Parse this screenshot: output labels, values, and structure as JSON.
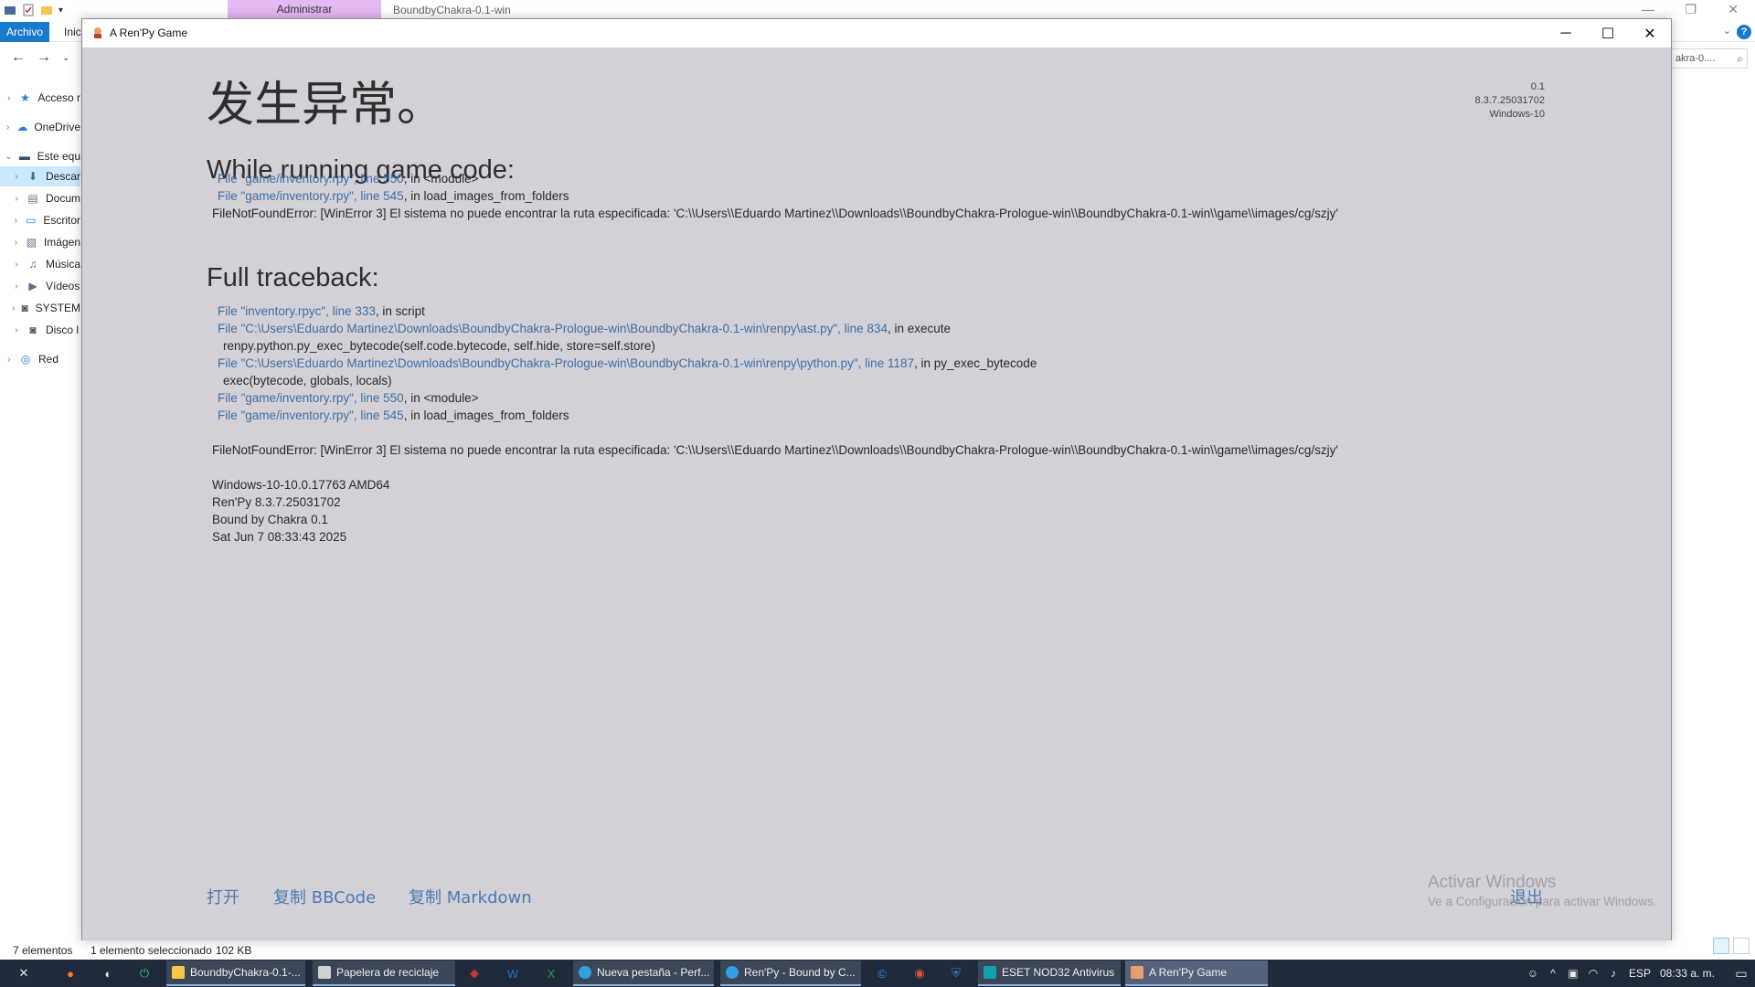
{
  "explorer": {
    "title": "BoundbyChakra-0.1-win",
    "manage_tab": "Administrar",
    "ribbon": {
      "file": "Archivo",
      "home": "Inic"
    },
    "search_text": "akra-0....",
    "sidebar": [
      {
        "label": "Acceso r",
        "icon": "star-icon",
        "indent": 1,
        "chevron": true
      },
      {
        "label": "OneDrive",
        "icon": "cloud-icon",
        "indent": 1,
        "chevron": true
      },
      {
        "label": "Este equ",
        "icon": "computer-icon",
        "indent": 1,
        "chevron": true,
        "expanded": true
      },
      {
        "label": "Descar",
        "icon": "download-icon",
        "indent": 2,
        "chevron": true,
        "selected": true
      },
      {
        "label": "Docum",
        "icon": "document-icon",
        "indent": 2,
        "chevron": true
      },
      {
        "label": "Escritor",
        "icon": "desktop-icon",
        "indent": 2,
        "chevron": true
      },
      {
        "label": "Imágen",
        "icon": "image-icon",
        "indent": 2,
        "chevron": true
      },
      {
        "label": "Música",
        "icon": "music-icon",
        "indent": 2,
        "chevron": true
      },
      {
        "label": "Vídeos",
        "icon": "video-icon",
        "indent": 2,
        "chevron": true
      },
      {
        "label": "SYSTEM",
        "icon": "drive-icon",
        "indent": 2,
        "chevron": true
      },
      {
        "label": "Disco l",
        "icon": "drive-icon",
        "indent": 2,
        "chevron": true
      },
      {
        "label": "Red",
        "icon": "network-icon",
        "indent": 1,
        "chevron": true
      }
    ],
    "status": {
      "count": "7 elementos",
      "selection": "1 elemento seleccionado",
      "size": "102 KB"
    }
  },
  "renpy": {
    "window_title": "A Ren'Py Game",
    "heading": "发生异常。",
    "version": [
      "0.1",
      "8.3.7.25031702",
      "Windows-10"
    ],
    "section_running": "While running game code:",
    "running": [
      {
        "link": "File \"game/inventory.rpy\", line 550",
        "rest": ", in <module>"
      },
      {
        "link": "File \"game/inventory.rpy\", line 545",
        "rest": ", in load_images_from_folders"
      }
    ],
    "running_error": "FileNotFoundError: [WinError 3] El sistema no puede encontrar la ruta especificada: 'C:\\\\Users\\\\Eduardo Martinez\\\\Downloads\\\\BoundbyChakra-Prologue-win\\\\BoundbyChakra-0.1-win\\\\game\\\\images/cg/szjy'",
    "section_full": "Full traceback:",
    "full": [
      {
        "kind": "frame",
        "link": "File \"inventory.rpyc\", line 333",
        "rest": ", in script"
      },
      {
        "kind": "frame",
        "link": "File \"C:\\Users\\Eduardo Martinez\\Downloads\\BoundbyChakra-Prologue-win\\BoundbyChakra-0.1-win\\renpy\\ast.py\", line 834",
        "rest": ", in execute"
      },
      {
        "kind": "code",
        "text": "renpy.python.py_exec_bytecode(self.code.bytecode, self.hide, store=self.store)"
      },
      {
        "kind": "frame",
        "link": "File \"C:\\Users\\Eduardo Martinez\\Downloads\\BoundbyChakra-Prologue-win\\BoundbyChakra-0.1-win\\renpy\\python.py\", line 1187",
        "rest": ", in py_exec_bytecode"
      },
      {
        "kind": "code",
        "text": "exec(bytecode, globals, locals)"
      },
      {
        "kind": "frame",
        "link": "File \"game/inventory.rpy\", line 550",
        "rest": ", in <module>"
      },
      {
        "kind": "frame",
        "link": "File \"game/inventory.rpy\", line 545",
        "rest": ", in load_images_from_folders"
      }
    ],
    "full_error": "FileNotFoundError: [WinError 3] El sistema no puede encontrar la ruta especificada: 'C:\\\\Users\\\\Eduardo Martinez\\\\Downloads\\\\BoundbyChakra-Prologue-win\\\\BoundbyChakra-0.1-win\\\\game\\\\images/cg/szjy'",
    "system_info": [
      "Windows-10-10.0.17763 AMD64",
      "Ren'Py 8.3.7.25031702",
      "Bound by Chakra 0.1",
      "Sat Jun  7 08:33:43 2025"
    ],
    "buttons": {
      "open": "打开",
      "copy_bbcode": "复制 BBCode",
      "copy_markdown": "复制 Markdown",
      "quit": "退出"
    },
    "activate": {
      "title": "Activar Windows",
      "subtitle": "Ve a Configuración para activar Windows."
    }
  },
  "taskbar": {
    "tasks": [
      {
        "label": "BoundbyChakra-0.1-...",
        "icon": "folder-icon"
      },
      {
        "label": "Papelera de reciclaje",
        "icon": "recycle-bin-icon"
      },
      {
        "label": "Nueva pestaña - Perf...",
        "icon": "edge-icon"
      },
      {
        "label": "Ren'Py - Bound by C...",
        "icon": "edge-icon"
      },
      {
        "label": "ESET NOD32 Antivirus",
        "icon": "eset-icon"
      },
      {
        "label": "A Ren'Py Game",
        "icon": "renpy-icon",
        "active": true
      }
    ],
    "language": "ESP",
    "clock": "08:33 a. m."
  },
  "colors": {
    "renpy_bg": "#d3d1d7",
    "renpy_link": "#3c6fa6",
    "taskbar_bg": "#1f2a3b",
    "explorer_accent": "#1979ca",
    "manage_tab": "#e5b9f3"
  }
}
